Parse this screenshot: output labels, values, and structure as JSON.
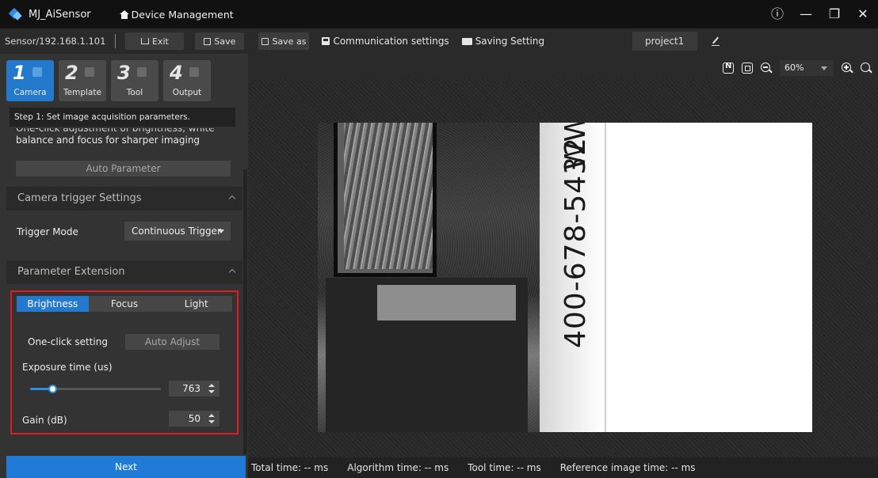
{
  "app": {
    "title": "MJ_AiSensor",
    "device_management": "Device Management"
  },
  "window_controls": {
    "info": "ⓘ",
    "minimize": "—",
    "restore": "❐",
    "close": "✕"
  },
  "toolbar": {
    "sensor_address": "Sensor/192.168.1.101",
    "exit_label": "Exit",
    "save_label": "Save",
    "save_as_label": "Save as",
    "communication_label": "Communication settings",
    "saving_setting_label": "Saving Setting",
    "project_name": "project1"
  },
  "steps": [
    {
      "num": "1",
      "label": "Camera",
      "active": true
    },
    {
      "num": "2",
      "label": "Template",
      "active": false
    },
    {
      "num": "3",
      "label": "Tool",
      "active": false
    },
    {
      "num": "4",
      "label": "Output",
      "active": false
    }
  ],
  "step_tip": "Step 1: Set image acquisition parameters.",
  "auto": {
    "desc_line1": "One-click adjustment of brightness, white",
    "desc_line2": "balance and focus for sharper imaging",
    "button_label": "Auto Parameter"
  },
  "camera_trigger": {
    "header": "Camera trigger Settings",
    "mode_label": "Trigger Mode",
    "mode_value": "Continuous Trigger"
  },
  "parameter_extension": {
    "header": "Parameter Extension",
    "tabs": [
      "Brightness",
      "Focus",
      "Light"
    ],
    "active_tab": "Brightness",
    "one_click_label": "One-click setting",
    "auto_adjust_label": "Auto Adjust",
    "exposure_label": "Exposure time (us)",
    "exposure_value": "763",
    "exposure_slider_fraction": 0.17,
    "gain_label": "Gain (dB)",
    "gain_value": "50"
  },
  "next_label": "Next",
  "viewer": {
    "zoom_value": "60%",
    "image_text": "400-678-5432",
    "image_text_top": "WW"
  },
  "status": {
    "total": "Total time: -- ms",
    "algorithm": "Algorithm time: -- ms",
    "tool": "Tool time: -- ms",
    "reference": "Reference image time: -- ms"
  },
  "colors": {
    "accent": "#2479cc",
    "highlight_border": "#e11b22"
  }
}
